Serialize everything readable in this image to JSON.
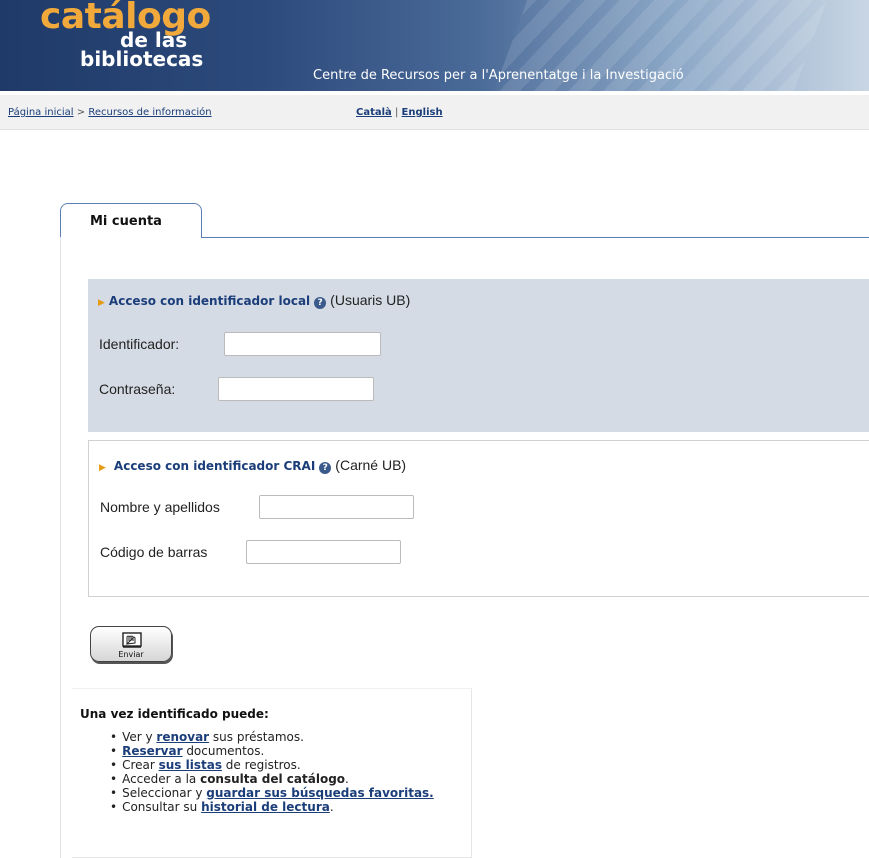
{
  "header": {
    "logo_line1": "catálogo",
    "logo_line2": "de las",
    "logo_line3": "bibliotecas",
    "subtitle": "Centre de Recursos per a l'Aprenentatge i la Investigació"
  },
  "breadcrumb": {
    "home": "Página inicial",
    "sep": ">",
    "current": "Recursos de información"
  },
  "languages": {
    "catala": "Català",
    "sep": "|",
    "english": "English"
  },
  "tab": {
    "label": "Mi cuenta"
  },
  "local_access": {
    "title": "Acceso con identificador local",
    "note": "(Usuaris UB)",
    "id_label": "Identificador:",
    "id_value": "",
    "password_label": "Contraseña:",
    "password_value": ""
  },
  "crai_access": {
    "title": "Acceso con identificador CRAI",
    "note": "(Carné UB)",
    "name_label": "Nombre y apellidos",
    "name_value": "",
    "barcode_label": "Código de barras",
    "barcode_value": ""
  },
  "submit": {
    "label": "Enviar"
  },
  "info": {
    "title": "Una vez identificado puede:",
    "items": [
      {
        "pre": "Ver y ",
        "link": "renovar",
        "post": " sus préstamos."
      },
      {
        "pre": "",
        "link": "Reservar",
        "post": " documentos."
      },
      {
        "pre": "Crear ",
        "link": "sus listas",
        "post": " de registros."
      },
      {
        "pre": "Acceder a la ",
        "bold": "consulta del catálogo",
        "post": "."
      },
      {
        "pre": "Seleccionar y ",
        "link": "guardar sus búsquedas favoritas.",
        "post": ""
      },
      {
        "pre": "Consultar su ",
        "link": "historial de lectura",
        "post": "."
      }
    ]
  },
  "colors": {
    "banner": "#2c4a7c",
    "logo_orange": "#f2a93b",
    "link": "#1b3e7a",
    "panel_bg": "#d5dbe4",
    "arrow": "#e59c14"
  }
}
